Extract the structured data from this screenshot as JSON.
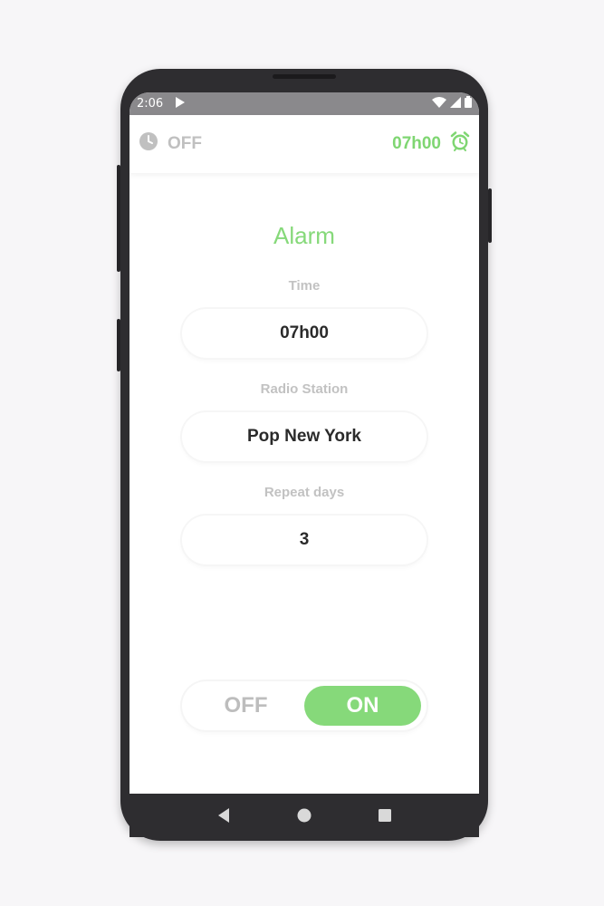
{
  "statusbar": {
    "time": "2:06"
  },
  "appbar": {
    "alarm_status": "OFF",
    "alarm_time": "07h00",
    "status_icon": "clock-icon",
    "alarm_icon": "alarm-clock-icon"
  },
  "main": {
    "title": "Alarm",
    "fields": [
      {
        "label": "Time",
        "value": "07h00"
      },
      {
        "label": "Radio Station",
        "value": "Pop New York"
      },
      {
        "label": "Repeat days",
        "value": "3"
      }
    ],
    "toggle": {
      "off_label": "OFF",
      "on_label": "ON",
      "selected": "ON"
    }
  },
  "colors": {
    "accent": "#86d97a",
    "muted": "#c0c0c0",
    "frame": "#2e2d30"
  }
}
